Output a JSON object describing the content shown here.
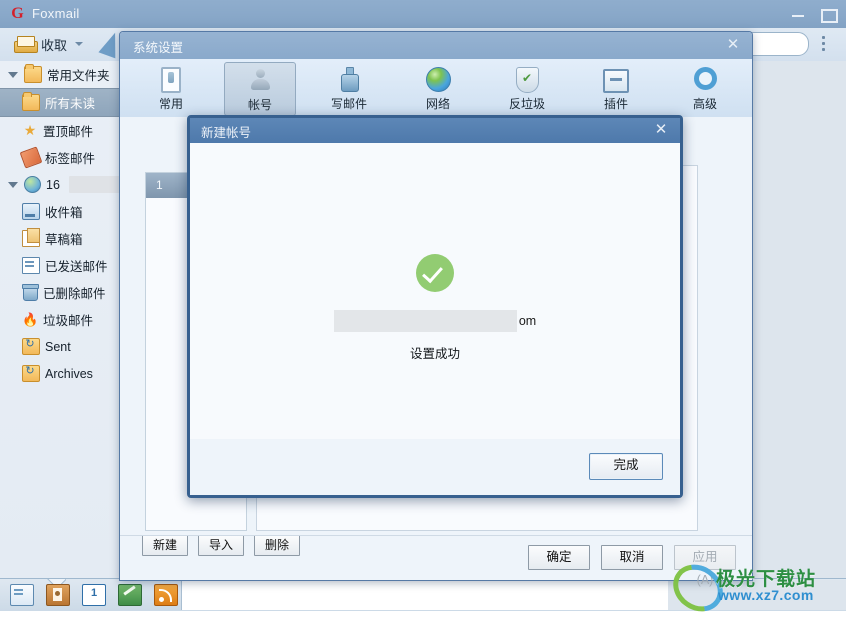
{
  "app": {
    "name": "Foxmail",
    "logo_letter": "G",
    "window_controls": {
      "minimize": "–",
      "maximize": "□"
    }
  },
  "toolbar": {
    "receive_label": "收取",
    "receive_icon": "inbox-icon",
    "compose_icon": "pen-icon",
    "dropdown_icon": "caret-down-icon",
    "search": {
      "value": "",
      "placeholder": ""
    },
    "search_dropdown_icon": "double-chevron-down-icon",
    "more_icon": "kebab-menu-icon"
  },
  "sidebar": {
    "items": [
      {
        "label": "常用文件夹",
        "icon": "folder-icon",
        "expander": true,
        "level": 0,
        "selected": false
      },
      {
        "label": "所有未读",
        "icon": "folder-icon",
        "expander": false,
        "level": 1,
        "selected": true
      },
      {
        "label": "置顶邮件",
        "icon": "star-icon",
        "expander": false,
        "level": 1,
        "selected": false
      },
      {
        "label": "标签邮件",
        "icon": "tag-icon",
        "expander": false,
        "level": 1,
        "selected": false
      },
      {
        "label": "16",
        "icon": "globe-account-icon",
        "expander": true,
        "level": 0,
        "selected": false,
        "redacted": true
      },
      {
        "label": "收件箱",
        "icon": "inbox-folder-icon",
        "expander": false,
        "level": 1,
        "selected": false
      },
      {
        "label": "草稿箱",
        "icon": "draft-icon",
        "expander": false,
        "level": 1,
        "selected": false
      },
      {
        "label": "已发送邮件",
        "icon": "sent-icon",
        "expander": false,
        "level": 1,
        "selected": false
      },
      {
        "label": "已删除邮件",
        "icon": "trash-icon",
        "expander": false,
        "level": 1,
        "selected": false
      },
      {
        "label": "垃圾邮件",
        "icon": "junk-flame-icon",
        "expander": false,
        "level": 1,
        "selected": false
      },
      {
        "label": "Sent",
        "icon": "archive-folder-icon",
        "expander": false,
        "level": 1,
        "selected": false
      },
      {
        "label": "Archives",
        "icon": "archive-folder-icon",
        "expander": false,
        "level": 1,
        "selected": false
      }
    ]
  },
  "module_bar": {
    "icons": [
      "mail-icon",
      "contacts-icon",
      "calendar-icon",
      "notes-icon",
      "rss-icon"
    ],
    "calendar_day": "1"
  },
  "settings_dialog": {
    "title": "系统设置",
    "close_icon": "close-icon",
    "tabs": [
      {
        "label": "常用",
        "icon": "general-icon",
        "active": false
      },
      {
        "label": "帐号",
        "icon": "account-icon",
        "active": true
      },
      {
        "label": "写邮件",
        "icon": "compose-icon",
        "active": false
      },
      {
        "label": "网络",
        "icon": "globe-icon",
        "active": false
      },
      {
        "label": "反垃圾",
        "icon": "shield-check-icon",
        "active": false
      },
      {
        "label": "插件",
        "icon": "plugin-icon",
        "active": false
      },
      {
        "label": "高级",
        "icon": "gear-icon",
        "active": false
      }
    ],
    "account_list": [
      {
        "label": "1",
        "selected": true
      }
    ],
    "account_actions": [
      {
        "label": "新建",
        "disabled": false
      },
      {
        "label": "导入",
        "disabled": false
      },
      {
        "label": "删除",
        "disabled": false
      }
    ],
    "footer_buttons": [
      {
        "label": "确定",
        "disabled": false
      },
      {
        "label": "取消",
        "disabled": false
      },
      {
        "label": "应用(A)",
        "disabled": true
      }
    ]
  },
  "new_account_dialog": {
    "title": "新建帐号",
    "close_icon": "close-icon",
    "status_icon": "success-check-icon",
    "status_color": "#92cc72",
    "email_redacted": true,
    "email_suffix": "om",
    "success_text": "设置成功",
    "done_label": "完成"
  },
  "watermark": {
    "brand": "极光下载站",
    "url": "www.xz7.com",
    "brand_color": "#2d8f43",
    "url_color": "#2f8fd0"
  }
}
